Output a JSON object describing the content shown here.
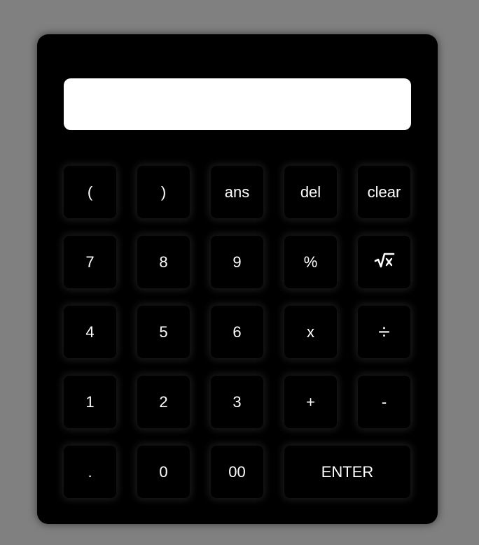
{
  "display": {
    "value": ""
  },
  "keys": {
    "row1": [
      "(",
      ")",
      "ans",
      "del",
      "clear"
    ],
    "row2": [
      "7",
      "8",
      "9",
      "%"
    ],
    "row3": [
      "4",
      "5",
      "6",
      "x"
    ],
    "row4": [
      "1",
      "2",
      "3",
      "+",
      "-"
    ],
    "row5": [
      ".",
      "0",
      "00",
      "ENTER"
    ],
    "sqrt_icon": "square-root-icon",
    "divide_icon": "divide-icon",
    "divide_symbol": "÷"
  }
}
